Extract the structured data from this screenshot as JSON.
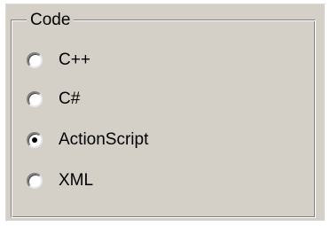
{
  "group": {
    "title": "Code"
  },
  "options": [
    {
      "label": "C++",
      "checked": false
    },
    {
      "label": "C#",
      "checked": false
    },
    {
      "label": "ActionScript",
      "checked": true
    },
    {
      "label": "XML",
      "checked": false
    }
  ],
  "colors": {
    "face": "#d4d0c8",
    "shadow": "#808080",
    "highlight": "#ffffff",
    "text": "#000000"
  },
  "icons": {
    "radio_checked": "radio-checked-icon",
    "radio_unchecked": "radio-unchecked-icon"
  }
}
